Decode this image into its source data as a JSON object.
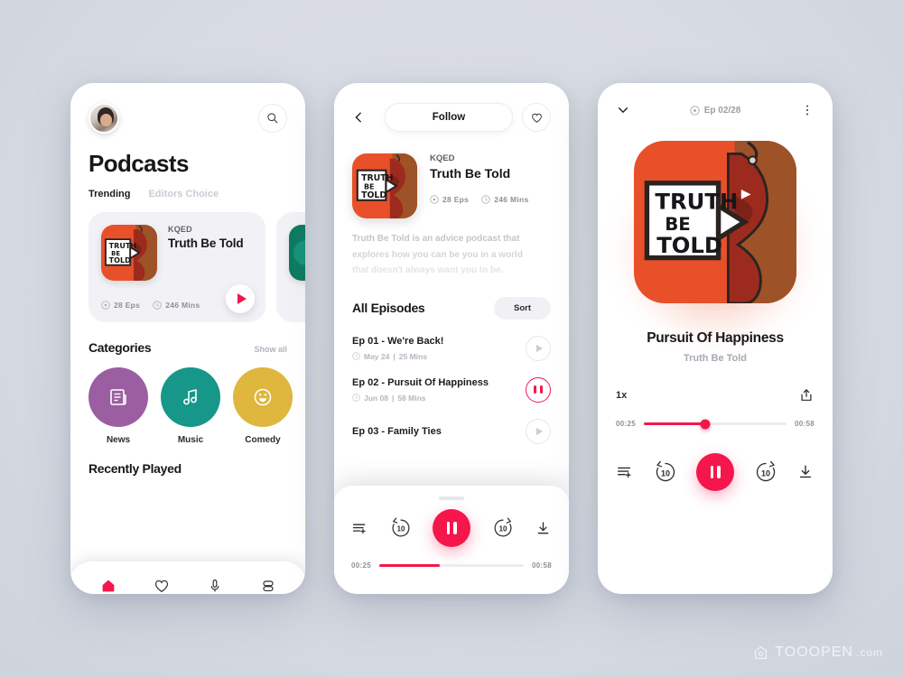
{
  "accent": "#F5164C",
  "background": "#d8dce3",
  "watermark": {
    "text": "TOOOPEN",
    "suffix": ".com"
  },
  "screen1": {
    "avatar_alt": "User avatar",
    "search_icon": "search-icon",
    "title": "Podcasts",
    "tabs": [
      {
        "label": "Trending",
        "active": true
      },
      {
        "label": "Editors Choice",
        "active": false
      }
    ],
    "featured_card": {
      "publisher": "KQED",
      "name": "Truth Be Told",
      "episodes": "28 Eps",
      "duration": "246 Mins",
      "play_icon": "play-icon"
    },
    "categories_section": {
      "title": "Categories",
      "show_all": "Show all",
      "items": [
        {
          "label": "News",
          "color": "#9B5FA1",
          "icon": "news-icon"
        },
        {
          "label": "Music",
          "color": "#17968A",
          "icon": "music-note-icon"
        },
        {
          "label": "Comedy",
          "color": "#DFB63E",
          "icon": "smiley-icon"
        }
      ]
    },
    "recently_played": "Recently Played",
    "tabbar": [
      {
        "name": "home-icon",
        "active": true
      },
      {
        "name": "heart-icon",
        "active": false
      },
      {
        "name": "mic-icon",
        "active": false
      },
      {
        "name": "library-icon",
        "active": false
      }
    ]
  },
  "screen2": {
    "back_icon": "chevron-left-icon",
    "follow_label": "Follow",
    "like_icon": "heart-icon",
    "podcast": {
      "publisher": "KQED",
      "name": "Truth Be Told",
      "episodes": "28 Eps",
      "duration": "246 Mins",
      "description_lines": [
        "Truth Be Told is an advice podcast that",
        "explores how you can be you in a world",
        "that doesn't always want you to be."
      ]
    },
    "episodes_section": {
      "title": "All Episodes",
      "sort_label": "Sort",
      "items": [
        {
          "title": "Ep 01 - We're Back!",
          "date": "May 24",
          "length": "25 Mins",
          "state": "paused"
        },
        {
          "title": "Ep 02 - Pursuit Of Happiness",
          "date": "Jun 08",
          "length": "58 Mins",
          "state": "playing"
        },
        {
          "title": "Ep 03 - Family Ties",
          "date": "",
          "length": "",
          "state": "paused"
        }
      ]
    },
    "player": {
      "queue_icon": "queue-add-icon",
      "rewind_label": "10",
      "forward_label": "10",
      "pause_icon": "pause-icon",
      "download_icon": "download-icon",
      "elapsed": "00:25",
      "total": "00:58",
      "progress_percent": 42
    }
  },
  "screen3": {
    "collapse_icon": "chevron-down-icon",
    "episode_counter": "Ep 02/28",
    "more_icon": "more-vertical-icon",
    "now_playing": {
      "title": "Pursuit Of Happiness",
      "subtitle": "Truth Be Told"
    },
    "speed": "1x",
    "share_icon": "share-icon",
    "player": {
      "elapsed": "00:25",
      "total": "00:58",
      "progress_percent": 43,
      "queue_icon": "queue-add-icon",
      "rewind_label": "10",
      "forward_label": "10",
      "pause_icon": "pause-icon",
      "download_icon": "download-icon"
    }
  }
}
